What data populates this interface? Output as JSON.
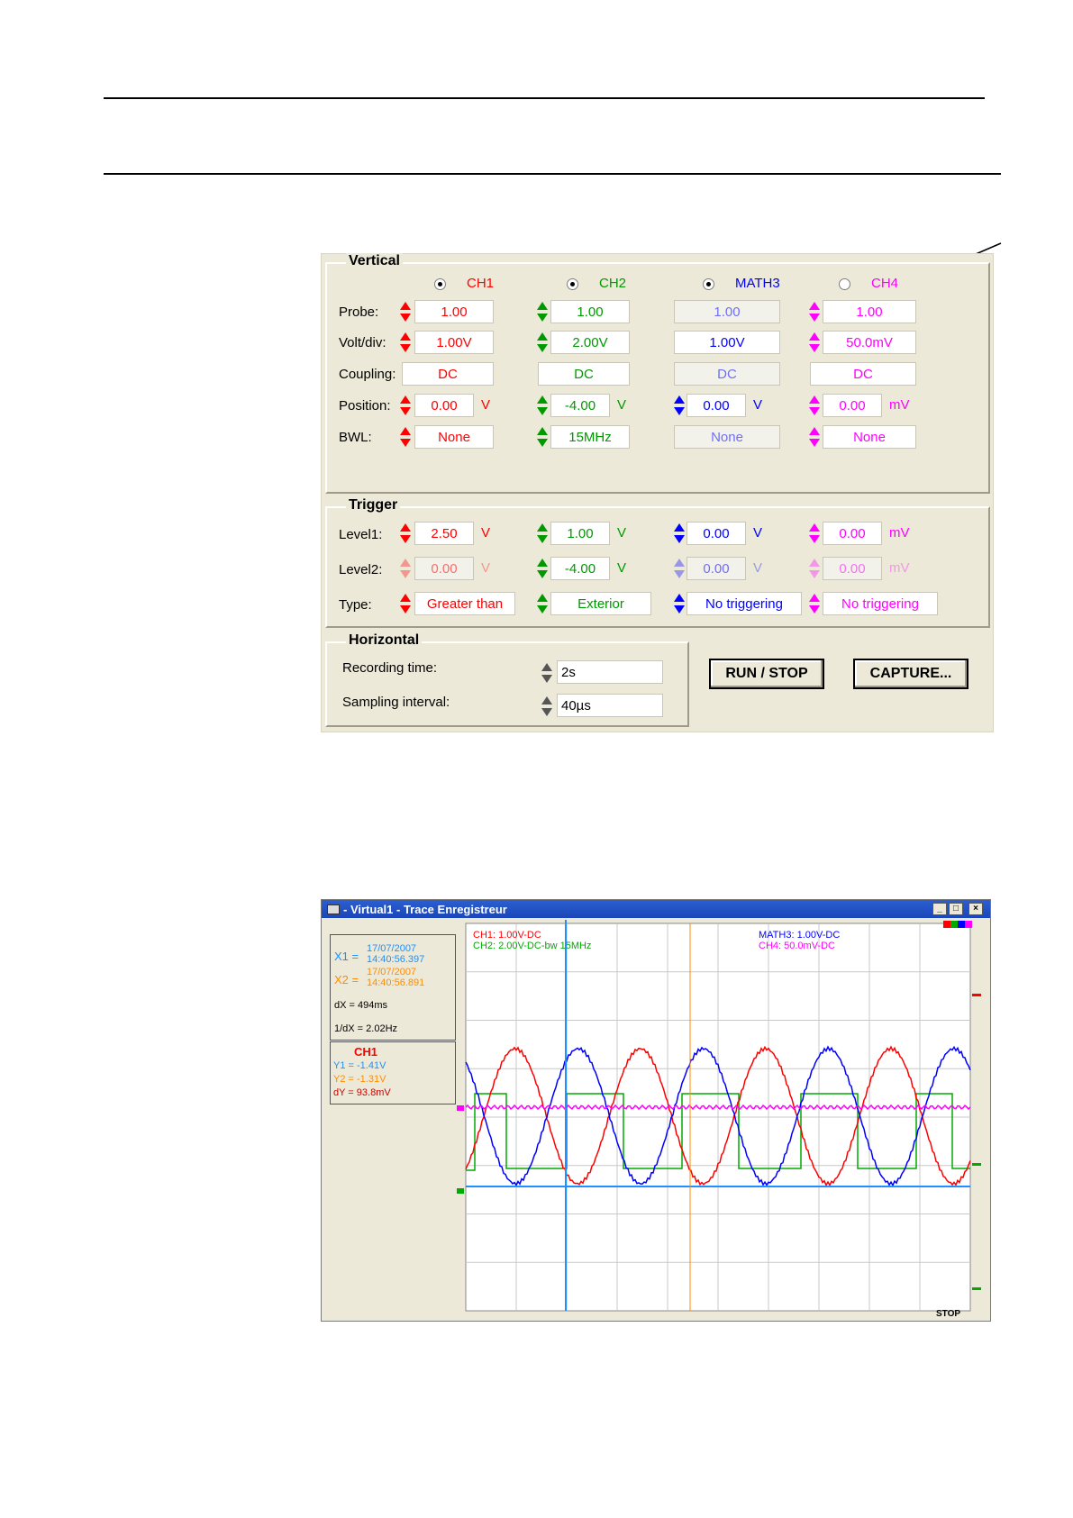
{
  "panel": {
    "vertical": {
      "title": "Vertical",
      "channels": [
        {
          "name": "CH1",
          "selected": true,
          "color": "#ff0000"
        },
        {
          "name": "CH2",
          "selected": true,
          "color": "#009900"
        },
        {
          "name": "MATH3",
          "selected": true,
          "color": "#0000ff"
        },
        {
          "name": "CH4",
          "selected": false,
          "color": "#ff00ff"
        }
      ],
      "rows": [
        {
          "label": "Probe:",
          "values": [
            "1.00",
            "1.00",
            "1.00",
            "1.00"
          ],
          "units": [
            "",
            "",
            "",
            ""
          ]
        },
        {
          "label": "Volt/div:",
          "values": [
            "1.00V",
            "2.00V",
            "1.00V",
            "50.0mV"
          ],
          "units": [
            "",
            "",
            "",
            ""
          ]
        },
        {
          "label": "Coupling:",
          "values": [
            "DC",
            "DC",
            "DC",
            "DC"
          ],
          "units": [
            "",
            "",
            "",
            ""
          ]
        },
        {
          "label": "Position:",
          "values": [
            "0.00",
            "-4.00",
            "0.00",
            "0.00"
          ],
          "units": [
            "V",
            "V",
            "V",
            "mV"
          ]
        },
        {
          "label": "BWL:",
          "values": [
            "None",
            "15MHz",
            "None",
            "None"
          ],
          "units": [
            "",
            "",
            "",
            ""
          ]
        }
      ]
    },
    "trigger": {
      "title": "Trigger",
      "rows": [
        {
          "label": "Level1:",
          "values": [
            "2.50",
            "1.00",
            "0.00",
            "0.00"
          ],
          "units": [
            "V",
            "V",
            "V",
            "mV"
          ]
        },
        {
          "label": "Level2:",
          "values": [
            "0.00",
            "-4.00",
            "0.00",
            "0.00"
          ],
          "units": [
            "V",
            "V",
            "V",
            "mV"
          ]
        },
        {
          "label": "Type:",
          "values": [
            "Greater than",
            "Exterior",
            "No triggering",
            "No triggering"
          ],
          "units": [
            "",
            "",
            "",
            ""
          ]
        }
      ]
    },
    "horizontal": {
      "title": "Horizontal",
      "recording_label": "Recording time:",
      "recording_value": "2s",
      "sampling_label": "Sampling interval:",
      "sampling_value": "40µs"
    },
    "run_stop_label": "RUN / STOP",
    "capture_label": "CAPTURE..."
  },
  "trace_window": {
    "title": "- Virtual1 - Trace Enregistreur",
    "window_buttons": [
      "_",
      "□",
      "×"
    ],
    "cursors": {
      "x1_label": "X1 =",
      "x1_date": "17/07/2007",
      "x1_time": "14:40:56.397",
      "x2_label": "X2 =",
      "x2_date": "17/07/2007",
      "x2_time": "14:40:56.891",
      "dx": "dX = 494ms",
      "inv_dx": "1/dX = 2.02Hz"
    },
    "channel_box": {
      "channel": "CH1",
      "y1": "Y1 = -1.41V",
      "y2": "Y2 = -1.31V",
      "dy": "dY = 93.8mV"
    },
    "legend": {
      "ch1": "CH1: 1.00V-DC",
      "ch2": "CH2: 2.00V-DC-bw 15MHz",
      "math3": "MATH3: 1.00V-DC",
      "ch4": "CH4: 50.0mV-DC"
    },
    "status": "STOP",
    "colors": {
      "ch1": "#ff0000",
      "ch2": "#00aa00",
      "math3": "#0000ff",
      "ch4": "#ff00ff",
      "x1": "#1e90ff",
      "x2": "#ff8c00"
    }
  }
}
